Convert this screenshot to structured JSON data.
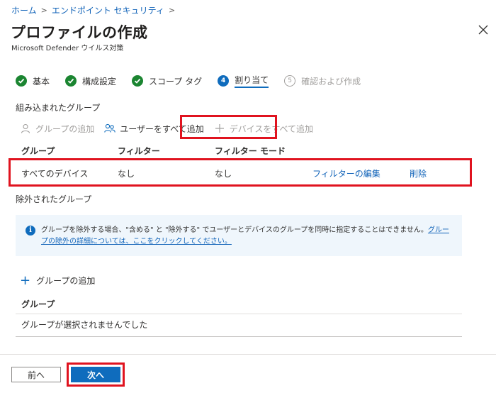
{
  "breadcrumb": {
    "home": "ホーム",
    "endpoint_security": "エンドポイント セキュリティ"
  },
  "page": {
    "title": "プロファイルの作成",
    "subtitle": "Microsoft Defender ウイルス対策",
    "more": "···"
  },
  "steps": [
    {
      "label": "基本",
      "state": "done"
    },
    {
      "label": "構成設定",
      "state": "done"
    },
    {
      "label": "スコープ タグ",
      "state": "done"
    },
    {
      "number": "4",
      "label": "割り当て",
      "state": "current"
    },
    {
      "number": "5",
      "label": "確認および作成",
      "state": "future"
    }
  ],
  "included": {
    "label": "組み込まれたグループ",
    "toolbar": {
      "add_group": "グループの追加",
      "add_all_users": "ユーザーをすべて追加",
      "add_all_devices": "デバイスをすべて追加"
    },
    "columns": {
      "group": "グループ",
      "filter": "フィルター",
      "filter_mode": "フィルター モード"
    },
    "row": {
      "group": "すべてのデバイス",
      "filter": "なし",
      "filter_mode": "なし",
      "edit_filter": "フィルターの編集",
      "delete": "削除"
    }
  },
  "excluded": {
    "label": "除外されたグループ",
    "info_text": "グループを除外する場合、\"含める\" と \"除外する\" でユーザーとデバイスのグループを同時に指定することはできません。",
    "info_link": "グループの除外の詳細については、ここをクリックしてください。",
    "add_group": "グループの追加",
    "column": "グループ",
    "empty": "グループが選択されませんでした"
  },
  "footer": {
    "prev": "前へ",
    "next": "次へ"
  },
  "colors": {
    "accent": "#0f6cbd",
    "success": "#1b8531",
    "highlight": "#e0131f"
  }
}
